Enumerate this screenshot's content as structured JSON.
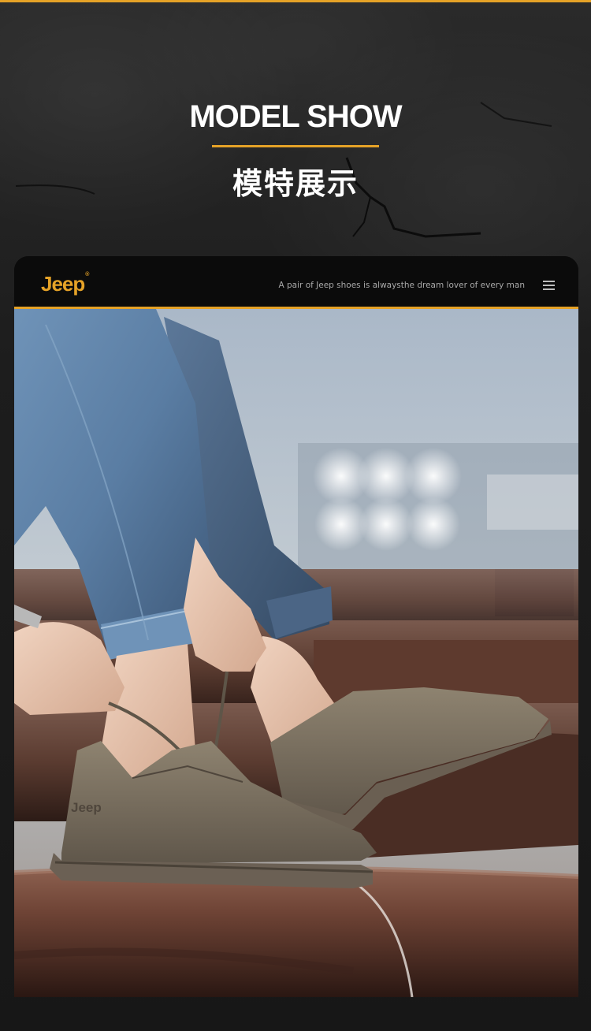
{
  "header": {
    "title": "MODEL SHOW",
    "subtitle": "模特展示"
  },
  "card": {
    "brand": "Jeep",
    "brand_mark": "®",
    "tagline": "A pair of Jeep shoes is alwaysthe dream lover of every man",
    "menu_icon": "hamburger-menu-icon",
    "shoe_brand_text": "Jeep"
  },
  "colors": {
    "accent": "#e5a227",
    "background": "#1c1c1c",
    "bar": "#0b0b0b"
  }
}
